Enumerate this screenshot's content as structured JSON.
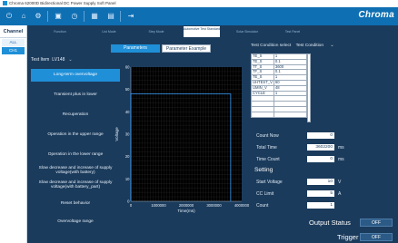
{
  "window": {
    "title": "Chroma 62000D Bidirectional DC Power Supply Soft Panel"
  },
  "brand": {
    "name": "Chroma"
  },
  "toolbar": {
    "icons": [
      "power-icon",
      "home-icon",
      "settings-icon",
      "image-icon",
      "clock-icon",
      "grid-icon",
      "table-icon",
      "exit-icon"
    ]
  },
  "channel": {
    "title": "Channel",
    "items": [
      "ALL",
      "CH1"
    ]
  },
  "tabs": [
    {
      "label": "Function"
    },
    {
      "label": "List Mode"
    },
    {
      "label": "Step Mode"
    },
    {
      "label": "Automotive Test Standard",
      "active": true
    },
    {
      "label": "Solar Simulator"
    },
    {
      "label": "Test Panel"
    }
  ],
  "param_tabs": {
    "parameters": "Parameters",
    "example": "Parameter Example"
  },
  "test_item": {
    "label": "Test Item",
    "value": "LV148"
  },
  "test_list": [
    "Long-term overvoltage",
    "Transient plus in lower",
    "Recuperation",
    "Operation in the upper range",
    "Operation in the lower range",
    "Slow decrease and increase of supply voltage(with battery)",
    "Slow decrease and increase of supply voltage(with battery_part)",
    "Reset behavior",
    "Overvoltage range"
  ],
  "selected_test_index": 0,
  "chart_data": {
    "type": "line",
    "ylabel": "Voltage",
    "xlabel": "Time(ms)",
    "ylim": [
      0,
      60
    ],
    "xlim": [
      0,
      4000000
    ],
    "yticks": [
      "60",
      "50",
      "40",
      "30",
      "20",
      "10",
      "0"
    ],
    "xticks": [
      "0",
      "1000000",
      "2000000",
      "3000000",
      "4000000"
    ],
    "series": [
      {
        "x": [
          0,
          0,
          3602200,
          3602200
        ],
        "y": [
          0,
          48,
          48,
          0
        ]
      }
    ]
  },
  "test_condition": {
    "label": "Test Condition select",
    "value": "Test Condition",
    "rows": [
      {
        "k": "TE_S",
        "v": "1"
      },
      {
        "k": "TE_S",
        "v": "0.1"
      },
      {
        "k": "TT_S",
        "v": "3600"
      },
      {
        "k": "TF_S",
        "v": "0.1"
      },
      {
        "k": "TE_S",
        "v": "1"
      },
      {
        "k": "UHTEST_V",
        "v": "60"
      },
      {
        "k": "UMIN_V",
        "v": "48"
      },
      {
        "k": "CYCLE",
        "v": "1"
      },
      {
        "k": "",
        "v": ""
      },
      {
        "k": "",
        "v": ""
      },
      {
        "k": "",
        "v": ""
      },
      {
        "k": "",
        "v": ""
      }
    ]
  },
  "counters": {
    "count_now": {
      "label": "Count Now",
      "value": "0"
    },
    "total_time": {
      "label": "Total Time",
      "value": "3602200",
      "unit": "ms"
    },
    "time_count": {
      "label": "Time Count",
      "value": "0",
      "unit": "ms"
    }
  },
  "setting": {
    "title": "Setting",
    "start_voltage": {
      "label": "Start Voltage",
      "value": "10",
      "unit": "V"
    },
    "cc_limit": {
      "label": "CC Limit",
      "value": "5",
      "unit": "A"
    },
    "count": {
      "label": "Count",
      "value": "1"
    }
  },
  "output_status": {
    "label": "Output Status",
    "state": "OFF"
  },
  "trigger": {
    "label": "Trigger",
    "state": "OFF"
  },
  "colors": {
    "toolbar": "#0f6fb3",
    "panel": "#1b3b5c",
    "accent": "#1f8fd8"
  }
}
